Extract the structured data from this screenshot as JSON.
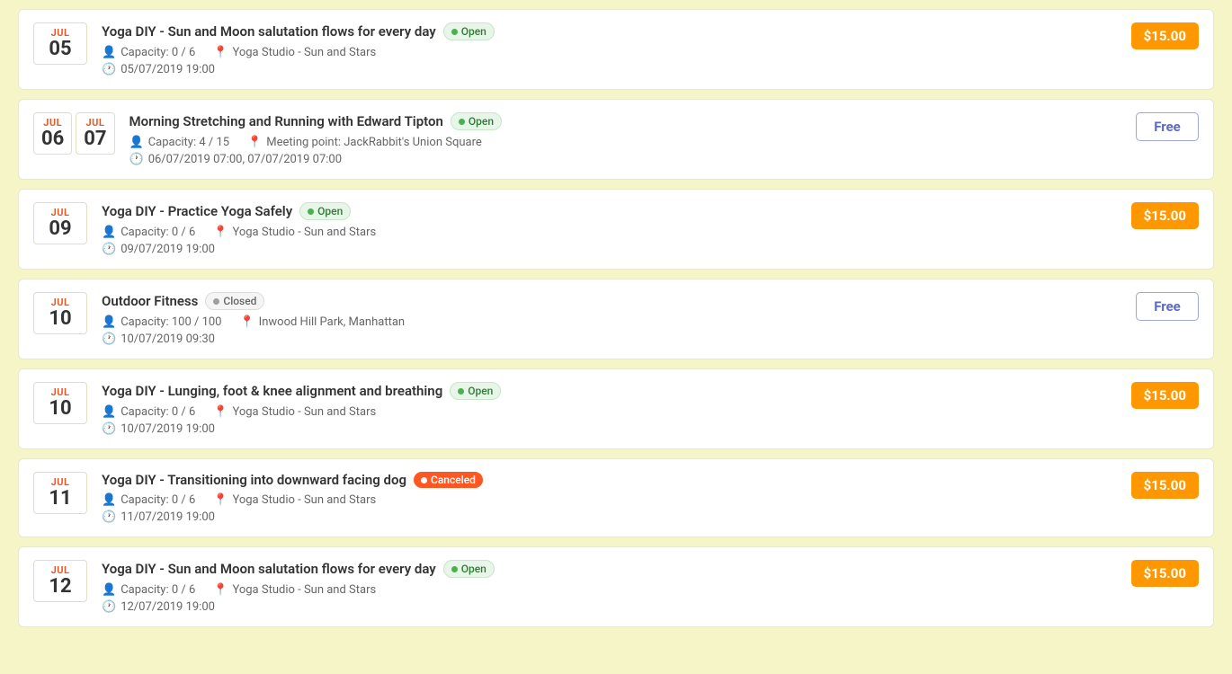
{
  "events": [
    {
      "id": "event-1",
      "date": {
        "month": "JUL",
        "day": "05",
        "multi": false
      },
      "title": "Yoga DIY - Sun and Moon salutation flows for every day",
      "status": "Open",
      "status_type": "open",
      "capacity": "Capacity: 0 / 6",
      "location": "Yoga Studio - Sun and Stars",
      "datetime": "05/07/2019 19:00",
      "price": "$15.00",
      "price_type": "paid"
    },
    {
      "id": "event-2",
      "date": {
        "month1": "JUL",
        "day1": "06",
        "month2": "JUL",
        "day2": "07",
        "multi": true
      },
      "title": "Morning Stretching and Running with Edward Tipton",
      "status": "Open",
      "status_type": "open",
      "capacity": "Capacity: 4 / 15",
      "location": "Meeting point: JackRabbit's Union Square",
      "datetime": "06/07/2019 07:00, 07/07/2019 07:00",
      "price": "Free",
      "price_type": "free"
    },
    {
      "id": "event-3",
      "date": {
        "month": "JUL",
        "day": "09",
        "multi": false
      },
      "title": "Yoga DIY - Practice Yoga Safely",
      "status": "Open",
      "status_type": "open",
      "capacity": "Capacity: 0 / 6",
      "location": "Yoga Studio - Sun and Stars",
      "datetime": "09/07/2019 19:00",
      "price": "$15.00",
      "price_type": "paid"
    },
    {
      "id": "event-4",
      "date": {
        "month": "JUL",
        "day": "10",
        "multi": false
      },
      "title": "Outdoor Fitness",
      "status": "Closed",
      "status_type": "closed",
      "capacity": "Capacity: 100 / 100",
      "location": "Inwood Hill Park, Manhattan",
      "datetime": "10/07/2019 09:30",
      "price": "Free",
      "price_type": "free"
    },
    {
      "id": "event-5",
      "date": {
        "month": "JUL",
        "day": "10",
        "multi": false
      },
      "title": "Yoga DIY - Lunging, foot & knee alignment and breathing",
      "status": "Open",
      "status_type": "open",
      "capacity": "Capacity: 0 / 6",
      "location": "Yoga Studio - Sun and Stars",
      "datetime": "10/07/2019 19:00",
      "price": "$15.00",
      "price_type": "paid"
    },
    {
      "id": "event-6",
      "date": {
        "month": "JUL",
        "day": "11",
        "multi": false
      },
      "title": "Yoga DIY - Transitioning into downward facing dog",
      "status": "Canceled",
      "status_type": "canceled",
      "capacity": "Capacity: 0 / 6",
      "location": "Yoga Studio - Sun and Stars",
      "datetime": "11/07/2019 19:00",
      "price": "$15.00",
      "price_type": "paid"
    },
    {
      "id": "event-7",
      "date": {
        "month": "JUL",
        "day": "12",
        "multi": false
      },
      "title": "Yoga DIY - Sun and Moon salutation flows for every day",
      "status": "Open",
      "status_type": "open",
      "capacity": "Capacity: 0 / 6",
      "location": "Yoga Studio - Sun and Stars",
      "datetime": "12/07/2019 19:00",
      "price": "$15.00",
      "price_type": "paid"
    }
  ],
  "icons": {
    "person": "👤",
    "location": "📍",
    "clock": "🕐"
  }
}
